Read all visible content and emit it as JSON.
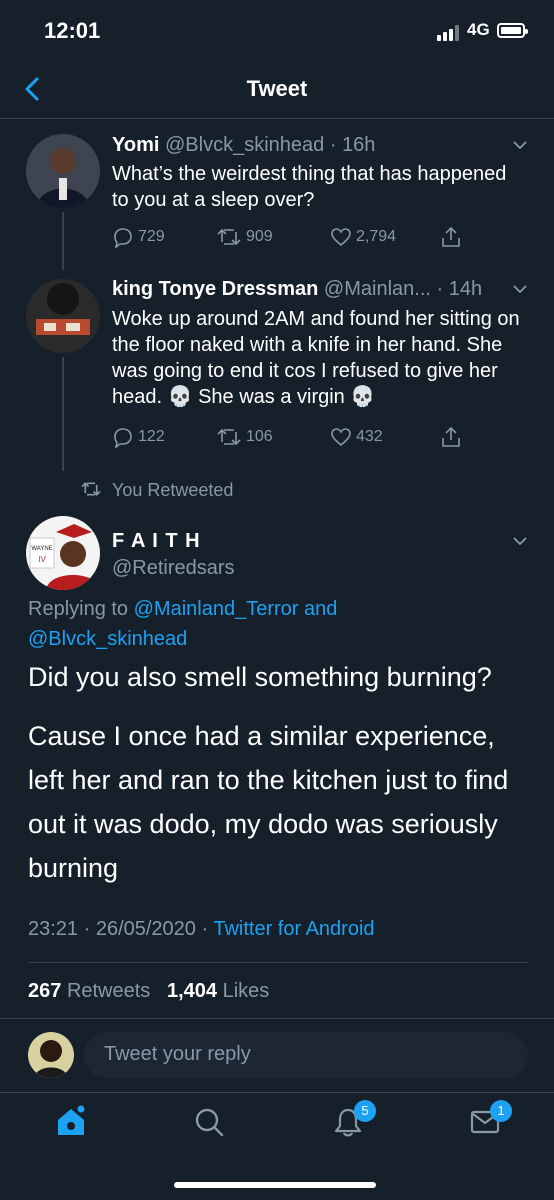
{
  "status_bar": {
    "time": "12:01",
    "network": "4G"
  },
  "header": {
    "title": "Tweet"
  },
  "tweets": [
    {
      "name": "Yomi",
      "handle": "@Blvck_skinhead",
      "dot": "·",
      "time": "16h",
      "text": "What’s the weirdest thing that has happened to you at a sleep over?",
      "replies": "729",
      "retweets": "909",
      "likes": "2,794"
    },
    {
      "name": "king Tonye Dressman",
      "handle": "@Mainlan...",
      "dot": "·",
      "time": "14h",
      "text": "Woke up around 2AM and found her sitting on the floor naked with a knife in her hand. She was going to end it cos I refused to give her head. 💀  She was a virgin 💀",
      "replies": "122",
      "retweets": "106",
      "likes": "432"
    }
  ],
  "retweet_context": "You Retweeted",
  "main_tweet": {
    "name": "F A I T H",
    "handle": "@Retiredsars",
    "replying_prefix": "Replying to",
    "replying_user1": "@Mainland_Terror",
    "replying_and": "and",
    "replying_user2": "@Blvck_skinhead",
    "text1": "Did you also smell something burning?",
    "text2": "Cause I once had a similar experience, left her and ran to the kitchen just to find out it was dodo, my dodo was seriously burning",
    "timestamp": "23:21 · 26/05/2020 ·",
    "source": "Twitter for Android",
    "retweet_count": "267",
    "retweet_label": "Retweets",
    "like_count": "1,404",
    "like_label": "Likes",
    "avatar_text": "WAYNE",
    "avatar_text2": "IV"
  },
  "reply": {
    "placeholder": "Tweet your reply"
  },
  "tab_bar": {
    "notifications_badge": "5",
    "messages_badge": "1"
  },
  "colors": {
    "background": "#15202b",
    "accent": "#1da1f2",
    "muted": "#8899a6",
    "divider": "#38444d"
  }
}
